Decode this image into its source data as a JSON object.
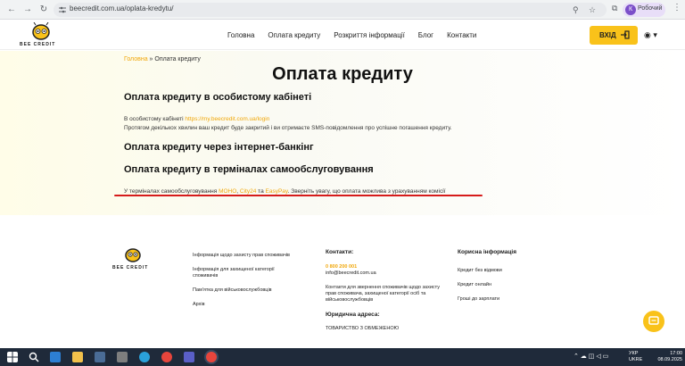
{
  "browser": {
    "url": "beecredit.com.ua/oplata-kredytu/",
    "profile_initial": "К",
    "profile_name": "Робочий"
  },
  "header": {
    "logo_text": "BEE CREDIT",
    "nav": [
      "Головна",
      "Оплата кредиту",
      "Розкриття інформації",
      "Блог",
      "Контакти"
    ],
    "login_label": "ВХІД"
  },
  "content": {
    "breadcrumb_home": "Головна",
    "breadcrumb_sep": " » ",
    "breadcrumb_current": "Оплата кредиту",
    "title": "Оплата кредиту",
    "section1_title": "Оплата кредиту в особистому кабінеті",
    "section1_text_prefix": "В особистому кабінеті ",
    "section1_link": "https://my.beecredit.com.ua/login",
    "section1_text2": "Протягом декількох хвилин ваш кредит буде закритий і ви отримаєте SMS-повідомлення про успішне погашення кредиту.",
    "section2_title": "Оплата кредиту через інтернет-банкінг",
    "section3_title": "Оплата кредиту в терміналах самообслуговування",
    "section3_text_prefix": "У терміналах самообслуговування ",
    "section3_link1": "МОНО",
    "section3_comma": ", ",
    "section3_link2": "City24",
    "section3_and": " та ",
    "section3_link3": "EasyPay",
    "section3_text_suffix": ". Зверніть увагу, що оплата можлива з урахуванням комісії"
  },
  "footer": {
    "logo_text": "BEE CREDIT",
    "links": [
      "Інформація щодо захисту прав споживачів",
      "Інформація для захищеної категорії споживачів",
      "Пам'ятка для військовослужбовців",
      "Архів"
    ],
    "contacts_title": "Контакти:",
    "phone": "0 800 200 001",
    "email": "info@beecredit.com.ua",
    "contacts_note": "Контакти для звернення споживачів щодо захисту прав споживача, захищеної категорії осіб та військовослужбовців",
    "address_title": "Юридична адреса:",
    "address_text": "ТОВАРИСТВО З ОБМЕЖЕНОЮ",
    "useful_title": "Корисна інформація",
    "useful_links": [
      "Кредит без відмови",
      "Кредит онлайн",
      "Гроші до зарплати"
    ]
  },
  "taskbar": {
    "lang_top": "УКР",
    "lang_bottom": "UKRE",
    "time": "17:00",
    "date": "08.09.2025"
  },
  "colors": {
    "accent": "#f9c21a",
    "link": "#f0a70a",
    "underline": "#d61b1b"
  }
}
